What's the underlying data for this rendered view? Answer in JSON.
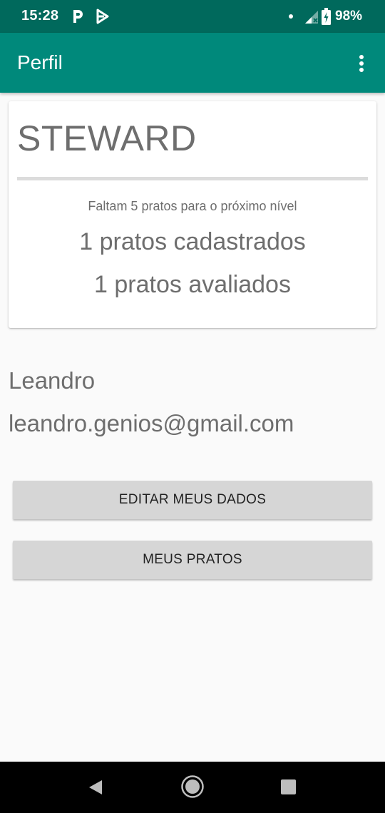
{
  "status_bar": {
    "time": "15:28",
    "battery": "98%",
    "icons": [
      "parking-app-icon",
      "play-store-icon",
      "notification-dot-icon",
      "signal-icon",
      "battery-charging-icon"
    ]
  },
  "app_bar": {
    "title": "Perfil",
    "menu_icon": "more-vert-icon"
  },
  "level_card": {
    "level": "STEWARD",
    "progress": 0,
    "next_level_text": "Faltam 5 pratos para o próximo nível",
    "dishes_registered": "1 pratos cadastrados",
    "dishes_rated": "1 pratos avaliados"
  },
  "user": {
    "name": "Leandro",
    "email": "leandro.genios@gmail.com"
  },
  "buttons": {
    "edit_data": "EDITAR MEUS DADOS",
    "my_dishes": "MEUS PRATOS"
  },
  "colors": {
    "status_bar": "#00695c",
    "app_bar": "#00897b",
    "background": "#fafafa",
    "button": "#d6d6d6"
  }
}
